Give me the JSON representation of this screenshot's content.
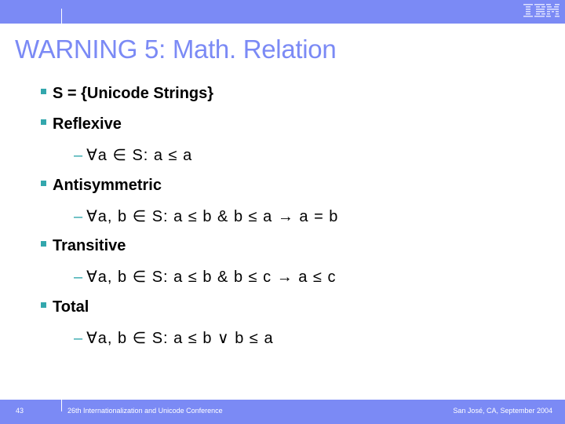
{
  "header": {
    "logo": "IBM",
    "logo_icon": "ibm-logo"
  },
  "slide": {
    "title": "WARNING 5: Math. Relation",
    "bullets": [
      {
        "level": 1,
        "text": "S = {Unicode Strings}"
      },
      {
        "level": 1,
        "text": "Reflexive"
      },
      {
        "level": 2,
        "text": "∀a ∈ S: a ≤ a"
      },
      {
        "level": 1,
        "text": "Antisymmetric"
      },
      {
        "level": 2,
        "text": "∀a, b ∈ S: a ≤ b & b ≤ a → a = b"
      },
      {
        "level": 1,
        "text": "Transitive"
      },
      {
        "level": 2,
        "text": "∀a, b ∈ S: a ≤ b & b ≤ c → a ≤ c"
      },
      {
        "level": 1,
        "text": "Total"
      },
      {
        "level": 2,
        "text": "∀a, b ∈ S: a ≤ b ∨ b ≤ a"
      }
    ],
    "dash": "–"
  },
  "footer": {
    "page_number": "43",
    "conference": "26th Internationalization and Unicode Conference",
    "location_date": "San José, CA, September 2004"
  },
  "colors": {
    "band": "#7b8af5",
    "title": "#7b8af5",
    "bullet": "#33a7ad"
  }
}
